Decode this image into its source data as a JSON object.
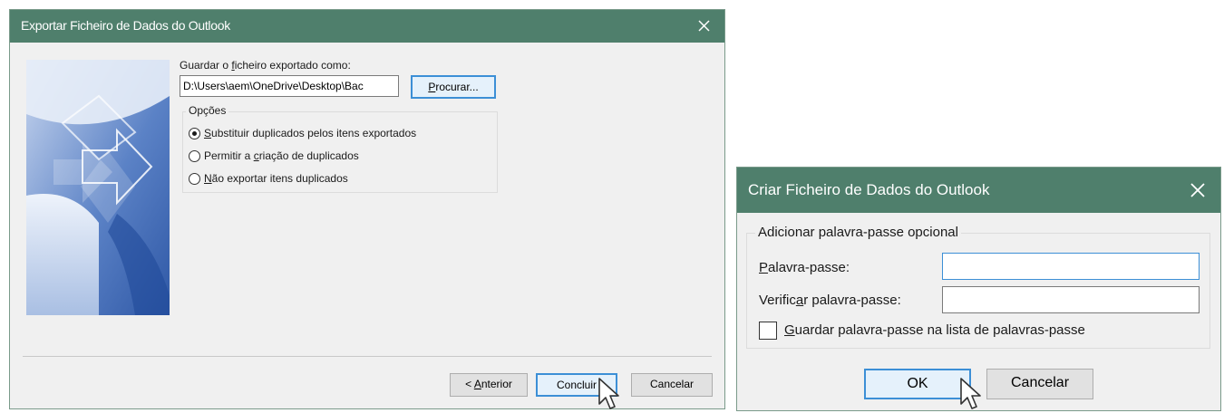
{
  "export_dialog": {
    "title": "Exportar Ficheiro de Dados do Outlook",
    "close_icon": "close-icon",
    "save_as_label_pre": "Guardar o ",
    "save_as_label_key": "f",
    "save_as_label_post": "icheiro exportado como:",
    "path_value": "D:\\Users\\aem\\OneDrive\\Desktop\\Bac",
    "browse_pre": "",
    "browse_key": "P",
    "browse_post": "rocurar...",
    "options_legend": "Opções",
    "options": [
      {
        "key": "S",
        "post": "ubstituir duplicados pelos itens exportados",
        "pre": "",
        "checked": true
      },
      {
        "pre": "Permitir a ",
        "key": "c",
        "post": "riação de duplicados",
        "checked": false
      },
      {
        "pre": "",
        "key": "N",
        "post": "ão exportar itens duplicados",
        "checked": false
      }
    ],
    "back_pre": "< ",
    "back_key": "A",
    "back_post": "nterior",
    "finish_label": "Concluir",
    "cancel_label": "Cancelar"
  },
  "password_dialog": {
    "title": "Criar Ficheiro de Dados do Outlook",
    "close_icon": "close-icon",
    "group_legend": "Adicionar palavra-passe opcional",
    "password_pre": "",
    "password_key": "P",
    "password_post": "alavra-passe:",
    "password_value": "",
    "verify_pre": "Verific",
    "verify_key": "a",
    "verify_post": "r palavra-passe:",
    "verify_value": "",
    "save_pre": "",
    "save_key": "G",
    "save_post": "uardar palavra-passe na lista de palavras-passe",
    "save_checked": false,
    "ok_label": "OK",
    "cancel_label": "Cancelar"
  },
  "colors": {
    "titlebar": "#4f7f6c",
    "dialog_bg": "#f0f0f0",
    "focus_border": "#3c8fd6"
  },
  "cursor_icon": "mouse-pointer-icon"
}
